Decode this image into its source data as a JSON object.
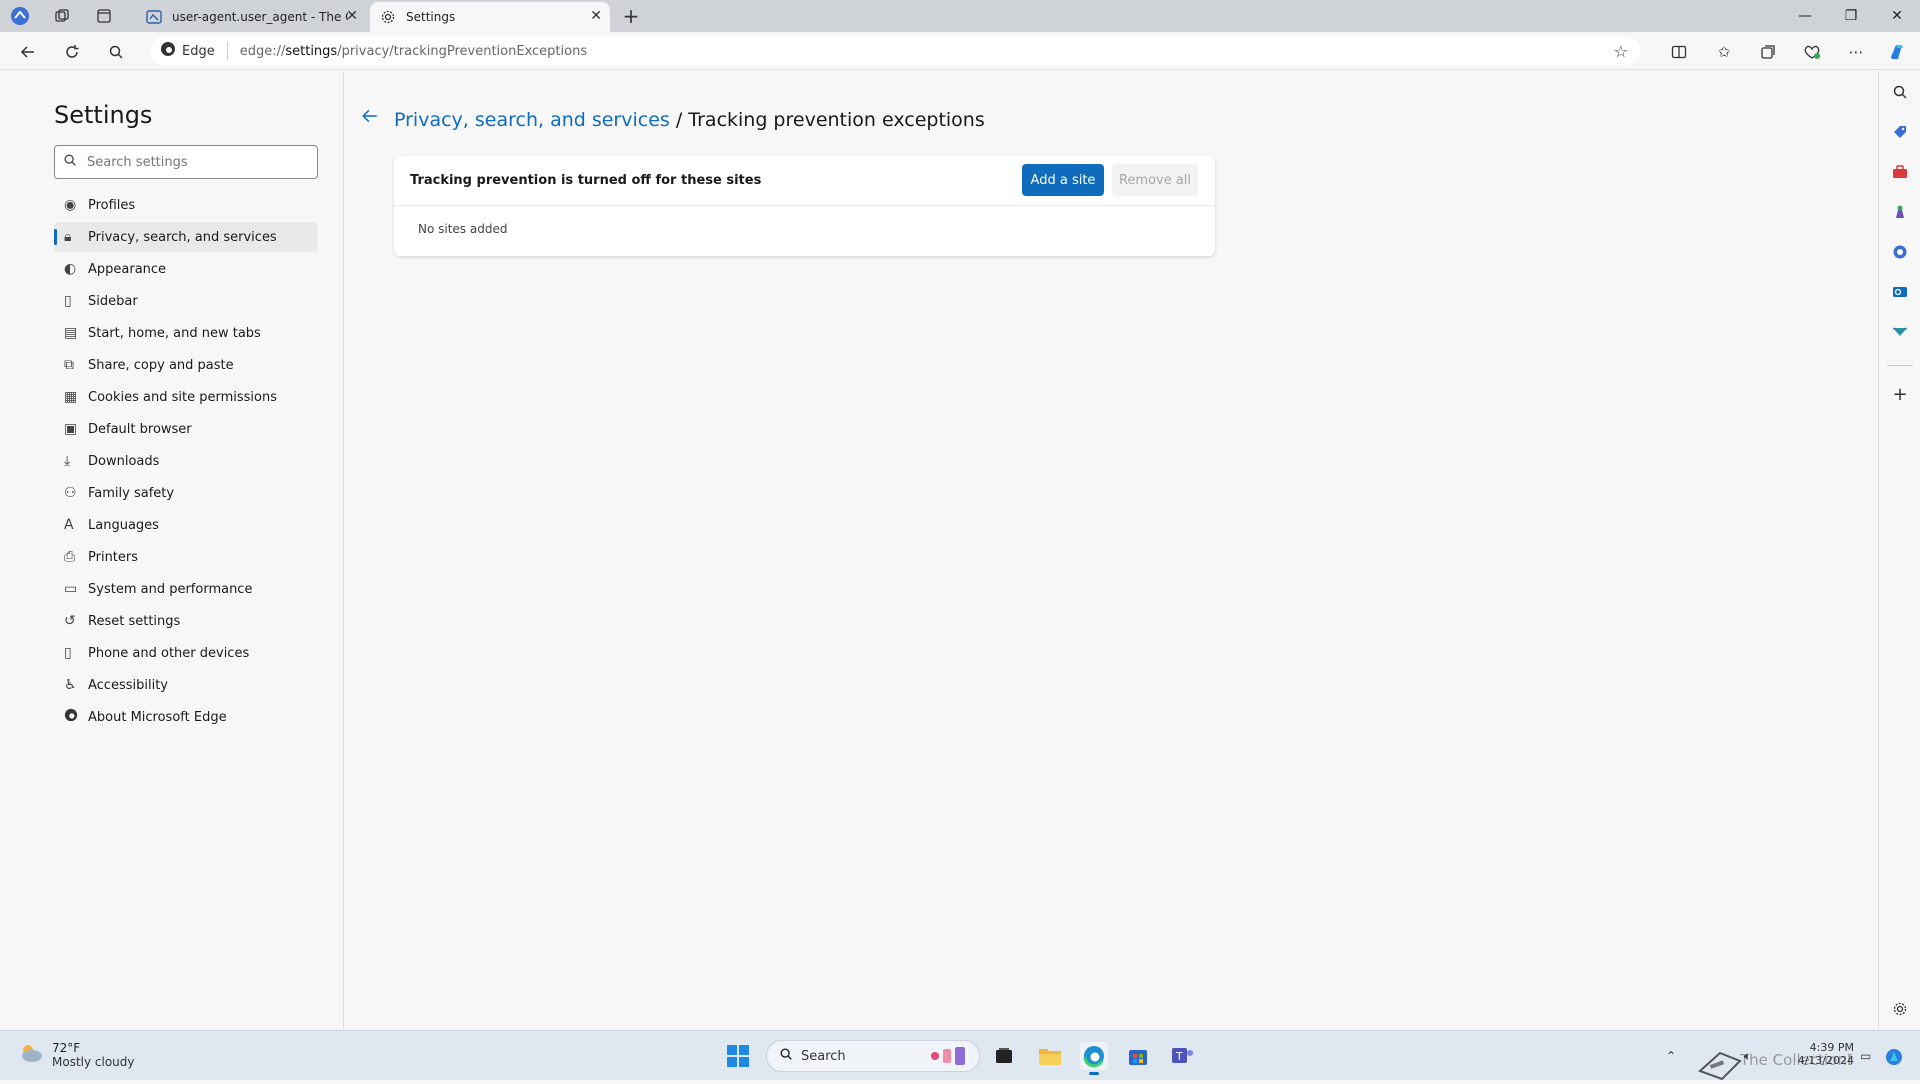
{
  "browser": {
    "tabs": [
      {
        "title": "user-agent.user_agent - The Coll",
        "active": false
      },
      {
        "title": "Settings",
        "active": true
      }
    ],
    "new_tab_symbol": "+",
    "address": {
      "chip_label": "Edge",
      "url_prefix": "edge://",
      "url_host": "settings",
      "url_path": "/privacy/trackingPreventionExceptions"
    }
  },
  "leftnav": {
    "title": "Settings",
    "search_placeholder": "Search settings",
    "items": [
      {
        "label": "Profiles",
        "icon": "profile-icon"
      },
      {
        "label": "Privacy, search, and services",
        "icon": "lock-icon",
        "selected": true
      },
      {
        "label": "Appearance",
        "icon": "appearance-icon"
      },
      {
        "label": "Sidebar",
        "icon": "sidebar-icon"
      },
      {
        "label": "Start, home, and new tabs",
        "icon": "home-icon"
      },
      {
        "label": "Share, copy and paste",
        "icon": "share-icon"
      },
      {
        "label": "Cookies and site permissions",
        "icon": "cookies-icon"
      },
      {
        "label": "Default browser",
        "icon": "default-browser-icon"
      },
      {
        "label": "Downloads",
        "icon": "download-icon"
      },
      {
        "label": "Family safety",
        "icon": "family-icon"
      },
      {
        "label": "Languages",
        "icon": "language-icon"
      },
      {
        "label": "Printers",
        "icon": "printer-icon"
      },
      {
        "label": "System and performance",
        "icon": "system-icon"
      },
      {
        "label": "Reset settings",
        "icon": "reset-icon"
      },
      {
        "label": "Phone and other devices",
        "icon": "phone-icon"
      },
      {
        "label": "Accessibility",
        "icon": "accessibility-icon"
      },
      {
        "label": "About Microsoft Edge",
        "icon": "edge-logo-icon"
      }
    ]
  },
  "main": {
    "breadcrumb_link": "Privacy, search, and services",
    "breadcrumb_sep": " / ",
    "breadcrumb_current": "Tracking prevention exceptions",
    "card": {
      "title": "Tracking prevention is turned off for these sites",
      "add_button": "Add a site",
      "remove_button": "Remove all",
      "empty_text": "No sites added"
    }
  },
  "taskbar": {
    "weather_temp": "72°F",
    "weather_desc": "Mostly cloudy",
    "search_label": "Search",
    "time": "4:39 PM",
    "date": "4/13/2024",
    "tray_overlay_text": "The CollectionBook"
  },
  "colors": {
    "accent": "#0f6cbd",
    "tabbar": "#cfd3d8",
    "page_bg": "#f7f7f7"
  }
}
